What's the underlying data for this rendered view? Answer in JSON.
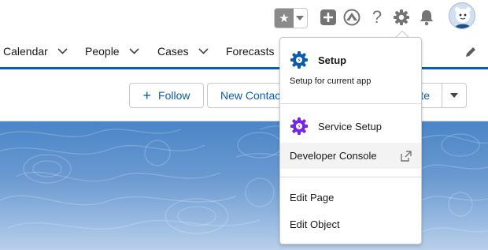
{
  "header": {
    "favorites_star": "★",
    "icons": [
      "favorites-star-icon",
      "favorites-caret-icon",
      "global-actions-icon",
      "guidance-center-icon",
      "help-icon",
      "setup-gear-icon",
      "notifications-bell-icon",
      "user-avatar"
    ],
    "help_glyph": "?"
  },
  "nav": {
    "items": [
      {
        "label": "Calendar",
        "has_menu": true
      },
      {
        "label": "People",
        "has_menu": true
      },
      {
        "label": "Cases",
        "has_menu": true
      },
      {
        "label": "Forecasts",
        "has_menu": false
      }
    ]
  },
  "actions": {
    "follow_label": "Follow",
    "follow_prefix": "+",
    "new_contact_label": "New Contact",
    "partial_button_label": "te"
  },
  "setup_menu": {
    "header_title": "Setup",
    "header_subtitle": "Setup for current app",
    "items": [
      {
        "label": "Service Setup"
      },
      {
        "label": "Developer Console"
      },
      {
        "label": "Edit Page"
      },
      {
        "label": "Edit Object"
      }
    ]
  },
  "colors": {
    "brand_blue": "#0b5cab",
    "setup_gear": "#0b5cab",
    "service_gear": "#7526e3",
    "banner": "#4a85c7"
  }
}
